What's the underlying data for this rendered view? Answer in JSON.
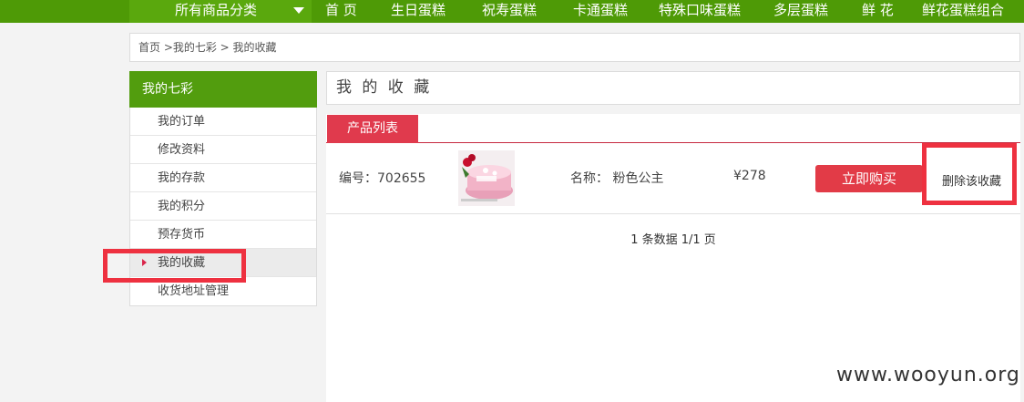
{
  "nav": {
    "category_all": "所有商品分类",
    "links": [
      "首 页",
      "生日蛋糕",
      "祝寿蛋糕",
      "卡通蛋糕",
      "特殊口味蛋糕",
      "多层蛋糕",
      "鲜 花",
      "鲜花蛋糕组合"
    ]
  },
  "breadcrumb": "首页 >我的七彩 > 我的收藏",
  "sidebar": {
    "title": "我的七彩",
    "items": [
      "我的订单",
      "修改资料",
      "我的存款",
      "我的积分",
      "预存货币",
      "我的收藏",
      "收货地址管理"
    ],
    "active_index": 5
  },
  "main": {
    "title": "我 的 收 藏",
    "tab_label": "产品列表",
    "item": {
      "code": "编号：702655",
      "name": "名称： 粉色公主",
      "price": "¥278",
      "buy_label": "立即购买",
      "delete_label": "删除该收藏"
    },
    "pager": "1 条数据 1/1 页"
  },
  "watermark": "www.wooyun.org",
  "colors": {
    "nav_green": "#4e9a06",
    "accent_red": "#e23b47",
    "highlight_red": "#ee3140"
  }
}
